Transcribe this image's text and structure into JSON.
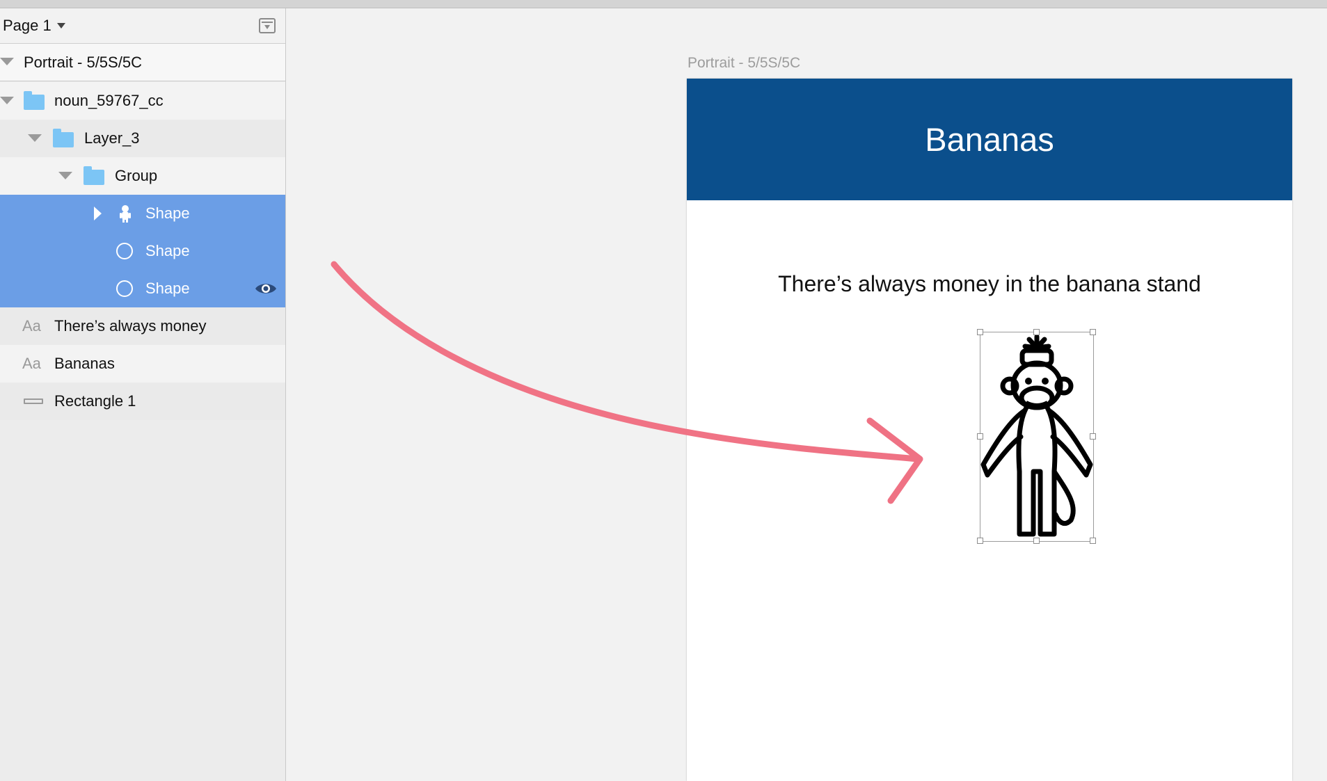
{
  "sidebar": {
    "page_selector": {
      "label": "Page 1"
    },
    "layers": [
      {
        "label": "Portrait - 5/5S/5C",
        "type": "artboard",
        "expanded": true
      },
      {
        "label": "noun_59767_cc",
        "type": "folder",
        "expanded": true
      },
      {
        "label": "Layer_3",
        "type": "folder",
        "expanded": true
      },
      {
        "label": "Group",
        "type": "folder",
        "expanded": true
      },
      {
        "label": "Shape",
        "type": "shape-monkey",
        "selected": true,
        "collapsed": true
      },
      {
        "label": "Shape",
        "type": "shape-oval",
        "selected": true
      },
      {
        "label": "Shape",
        "type": "shape-oval",
        "selected": true,
        "visibility_icon": "eye-icon"
      },
      {
        "label": "There’s always money",
        "type": "text",
        "icon": "Aa"
      },
      {
        "label": "Bananas",
        "type": "text",
        "icon": "Aa"
      },
      {
        "label": "Rectangle 1",
        "type": "rectangle"
      }
    ]
  },
  "canvas": {
    "artboard_label": "Portrait - 5/5S/5C",
    "nav_title": "Bananas",
    "tagline": "There’s always money in the banana stand",
    "image_icon": "sock-monkey-icon"
  },
  "colors": {
    "nav_bar": "#0b4f8c",
    "selection": "#6b9ee6",
    "folder": "#7cc5f5",
    "annotation_arrow": "#ef6b7e"
  }
}
